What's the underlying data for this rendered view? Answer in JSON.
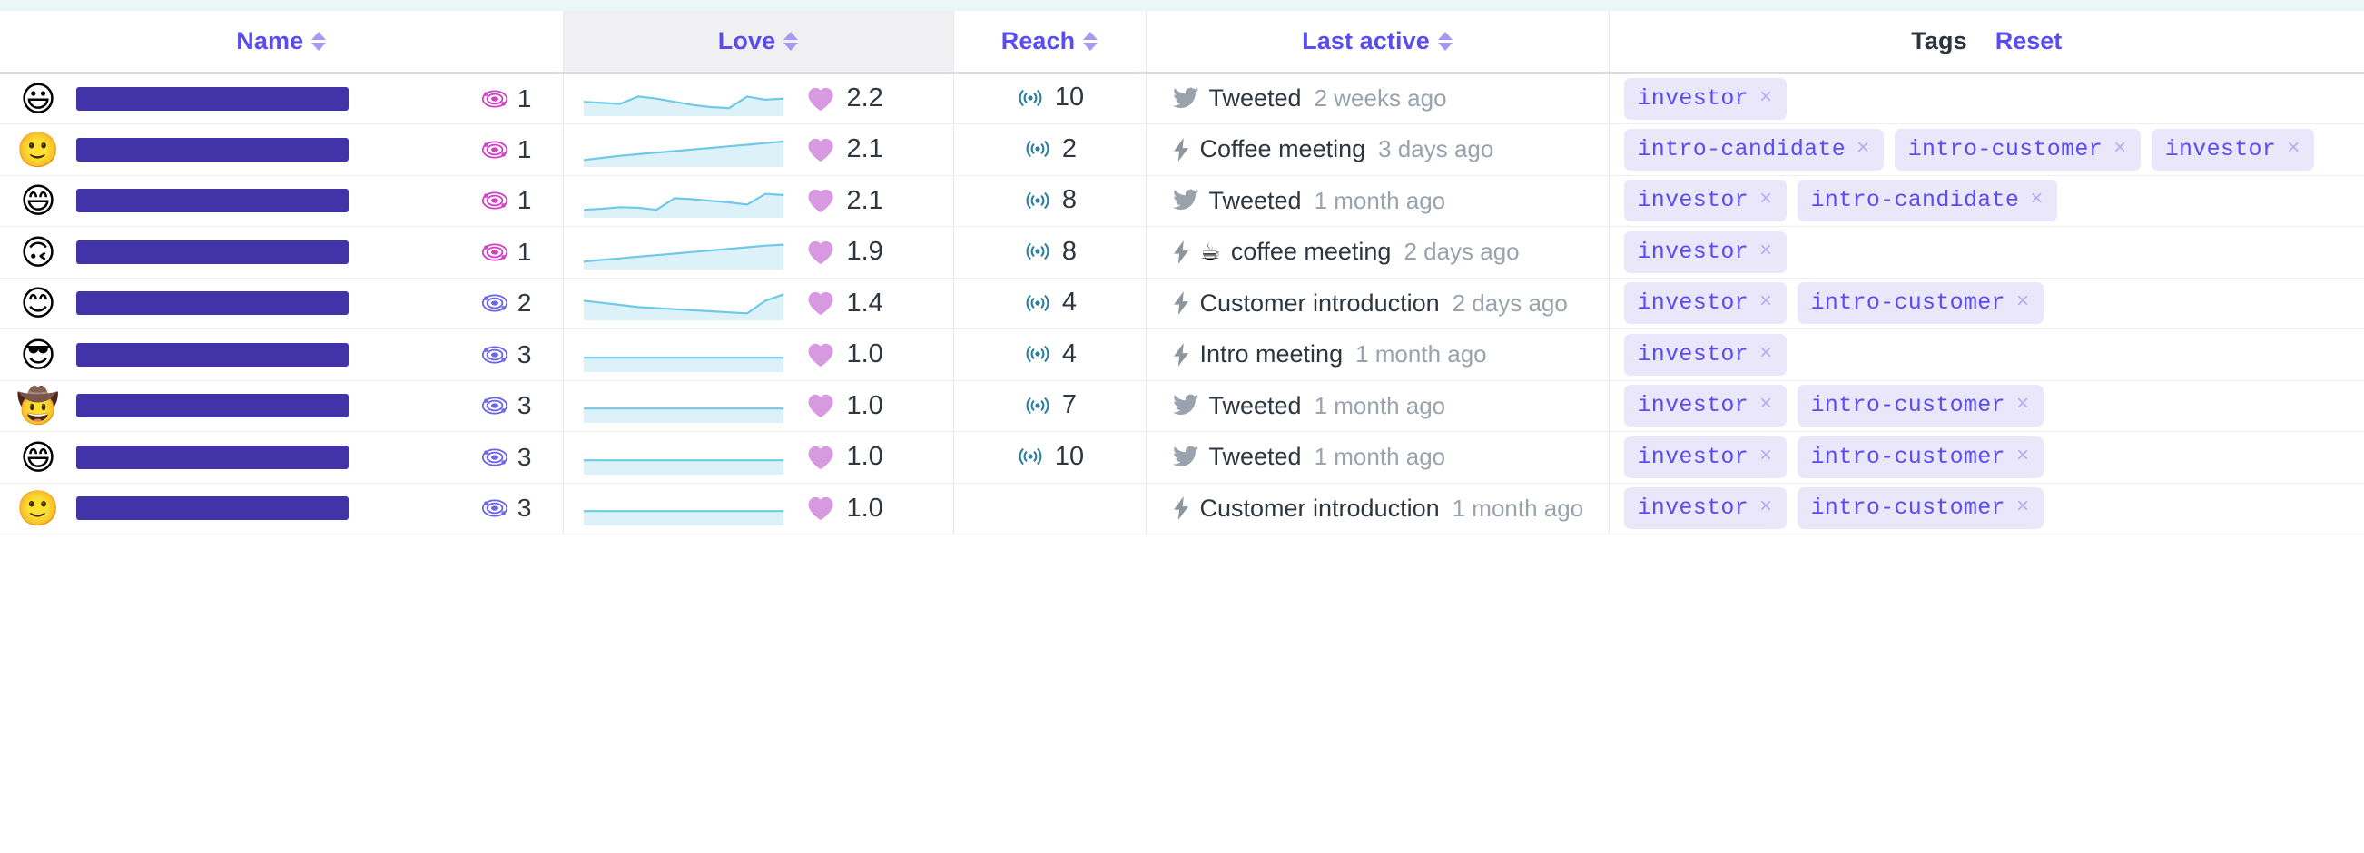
{
  "table": {
    "columns": [
      {
        "key": "name",
        "label": "Name",
        "sortable": true,
        "sorted": false,
        "label_color": "#5b4cf0"
      },
      {
        "key": "love",
        "label": "Love",
        "sortable": true,
        "sorted": true,
        "label_color": "#5b4cf0"
      },
      {
        "key": "reach",
        "label": "Reach",
        "sortable": true,
        "sorted": false,
        "label_color": "#5b4cf0"
      },
      {
        "key": "last_active",
        "label": "Last active",
        "sortable": true,
        "sorted": false,
        "label_color": "#5b4cf0"
      },
      {
        "key": "tags",
        "label": "Tags",
        "sortable": false,
        "sorted": false,
        "label_color": "#2d3440"
      }
    ],
    "tags_header": {
      "label": "Tags",
      "reset_label": "Reset"
    },
    "rows": [
      {
        "avatar": "😃",
        "name_redacted": true,
        "degree": "1",
        "degree_color": "#d13fc4",
        "love_value": "2.2",
        "love_spark": [
          62,
          60,
          58,
          72,
          68,
          62,
          56,
          52,
          50,
          72,
          66,
          68
        ],
        "reach": "10",
        "activity_icon": "twitter-icon",
        "activity_emoji": "",
        "activity_label": "Tweeted",
        "activity_time": "2 weeks ago",
        "tags": [
          "investor"
        ]
      },
      {
        "avatar": "🙂",
        "name_redacted": true,
        "degree": "1",
        "degree_color": "#d13fc4",
        "love_value": "2.1",
        "love_spark": [
          48,
          52,
          56,
          59,
          62,
          65,
          68,
          71,
          74,
          77,
          80,
          83
        ],
        "reach": "2",
        "activity_icon": "bolt-icon",
        "activity_emoji": "",
        "activity_label": "Coffee meeting",
        "activity_time": "3 days ago",
        "tags": [
          "intro-candidate",
          "intro-customer",
          "investor"
        ]
      },
      {
        "avatar": "😄",
        "name_redacted": true,
        "degree": "1",
        "degree_color": "#d13fc4",
        "love_value": "2.1",
        "love_spark": [
          50,
          52,
          55,
          54,
          50,
          72,
          70,
          67,
          64,
          60,
          80,
          78
        ],
        "reach": "8",
        "activity_icon": "twitter-icon",
        "activity_emoji": "",
        "activity_label": "Tweeted",
        "activity_time": "1 month ago",
        "tags": [
          "investor",
          "intro-candidate"
        ]
      },
      {
        "avatar": "🙃",
        "name_redacted": true,
        "degree": "1",
        "degree_color": "#d13fc4",
        "love_value": "1.9",
        "love_spark": [
          50,
          53,
          56,
          59,
          62,
          65,
          68,
          71,
          74,
          77,
          80,
          82
        ],
        "reach": "8",
        "activity_icon": "bolt-icon",
        "activity_emoji": "☕",
        "activity_label": "coffee meeting",
        "activity_time": "2 days ago",
        "tags": [
          "investor"
        ]
      },
      {
        "avatar": "😊",
        "name_redacted": true,
        "degree": "2",
        "degree_color": "#6b63e8",
        "love_value": "1.4",
        "love_spark": [
          72,
          68,
          64,
          60,
          58,
          56,
          54,
          52,
          50,
          48,
          72,
          84
        ],
        "reach": "4",
        "activity_icon": "bolt-icon",
        "activity_emoji": "",
        "activity_label": "Customer introduction",
        "activity_time": "2 days ago",
        "tags": [
          "investor",
          "intro-customer"
        ]
      },
      {
        "avatar": "😎",
        "name_redacted": true,
        "degree": "3",
        "degree_color": "#6b63e8",
        "love_value": "1.0",
        "love_spark": [
          62,
          62,
          62,
          62,
          62,
          62,
          62,
          62,
          62,
          62,
          62,
          62
        ],
        "reach": "4",
        "activity_icon": "bolt-icon",
        "activity_emoji": "",
        "activity_label": "Intro meeting",
        "activity_time": "1 month ago",
        "tags": [
          "investor"
        ]
      },
      {
        "avatar": "🤠",
        "name_redacted": true,
        "degree": "3",
        "degree_color": "#6b63e8",
        "love_value": "1.0",
        "love_spark": [
          62,
          62,
          62,
          62,
          62,
          62,
          62,
          62,
          62,
          62,
          62,
          62
        ],
        "reach": "7",
        "activity_icon": "twitter-icon",
        "activity_emoji": "",
        "activity_label": "Tweeted",
        "activity_time": "1 month ago",
        "tags": [
          "investor",
          "intro-customer"
        ]
      },
      {
        "avatar": "😄",
        "name_redacted": true,
        "degree": "3",
        "degree_color": "#6b63e8",
        "love_value": "1.0",
        "love_spark": [
          62,
          62,
          62,
          62,
          62,
          62,
          62,
          62,
          62,
          62,
          62,
          62
        ],
        "reach": "10",
        "activity_icon": "twitter-icon",
        "activity_emoji": "",
        "activity_label": "Tweeted",
        "activity_time": "1 month ago",
        "tags": [
          "investor",
          "intro-customer"
        ]
      },
      {
        "avatar": "🙂",
        "name_redacted": true,
        "degree": "3",
        "degree_color": "#6b63e8",
        "love_value": "1.0",
        "love_spark": [
          62,
          62,
          62,
          62,
          62,
          62,
          62,
          62,
          62,
          62,
          62,
          62
        ],
        "reach": "",
        "activity_icon": "bolt-icon",
        "activity_emoji": "",
        "activity_label": "Customer introduction",
        "activity_time": "1 month ago",
        "tags": [
          "investor",
          "intro-customer"
        ]
      }
    ]
  },
  "colors": {
    "accent_purple": "#5b4cf0",
    "redaction_bar": "#4333a8",
    "spark_line": "#6fc9e8",
    "spark_fill": "#ddf1f8",
    "heart": "#d79ae0",
    "reach_icon": "#2a7f9e",
    "tag_bg": "#ebe7fb",
    "tag_text": "#5b4cf0",
    "degree_first": "#d13fc4",
    "degree_other": "#6b63e8",
    "muted_text": "#9aa3ad"
  }
}
